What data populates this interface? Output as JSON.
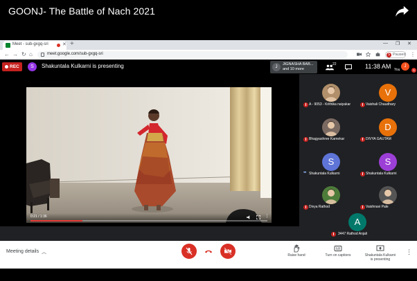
{
  "player": {
    "title": "GOONJ- The Battle of Nach 2021"
  },
  "browser": {
    "tab_title": "Meet - sub-gxgq-sri",
    "url": "meet.google.com/sub-gxgq-sri",
    "new_tab": "+",
    "profile_status": "Paused",
    "profile_initial": "S"
  },
  "meet": {
    "rec_label": "REC",
    "presenter_initial": "S",
    "presenter_text": "Shakuntala Kulkarni is presenting",
    "others": {
      "initial": "J",
      "line1": "JIGNASHA BAB...",
      "line2": "and 10 more"
    },
    "participant_count": "22",
    "time": "11:38 AM",
    "self_initial": "J",
    "self_label": "You",
    "self_badge": "5"
  },
  "video": {
    "timestamp": "0:21 / 1:36",
    "progress": 0.22
  },
  "participants": [
    {
      "name": "A - 9053 - Krithika naiyakar",
      "initial": "",
      "color": "#b08f6a",
      "photo": true,
      "state": "muted"
    },
    {
      "name": "Vaishali Chaudhary",
      "initial": "V",
      "color": "#e8710a",
      "photo": false,
      "state": "muted"
    },
    {
      "name": "Bhagyashree Karnekar",
      "initial": "",
      "color": "#7b6a62",
      "photo": true,
      "state": "muted"
    },
    {
      "name": "DIVYA GAUTAM",
      "initial": "D",
      "color": "#e8710a",
      "photo": false,
      "state": "muted"
    },
    {
      "name": "Shakuntala Kulkarni",
      "initial": "S",
      "color": "#5e74d6",
      "photo": false,
      "state": "speaking"
    },
    {
      "name": "Shakuntala Kulkarni",
      "initial": "S",
      "color": "#9c3fd6",
      "photo": false,
      "state": "muted"
    },
    {
      "name": "Divya Rathod",
      "initial": "",
      "color": "#4d7c3a",
      "photo": true,
      "state": "muted"
    },
    {
      "name": "Vaishnavi Pale",
      "initial": "",
      "color": "#555555",
      "photo": true,
      "state": "muted"
    }
  ],
  "last_participant": {
    "name": "3447 Rathod Anjali",
    "initial": "A",
    "color": "#00796b"
  },
  "bottom": {
    "meeting_details": "Meeting details",
    "raise_hand": "Raise hand",
    "captions": "Turn on captions",
    "presenting_line1": "Shakuntala Kulkarni",
    "presenting_line2": "is presenting"
  },
  "colors": {
    "danger": "#d93025",
    "meet_dark": "#202124"
  }
}
